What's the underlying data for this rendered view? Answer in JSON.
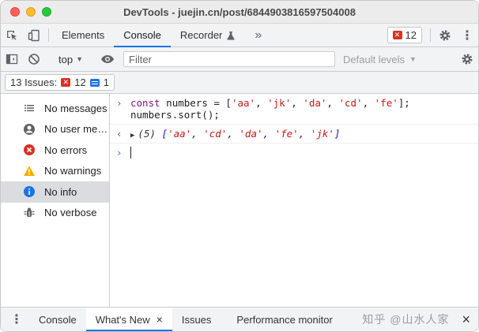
{
  "window": {
    "title": "DevTools - juejin.cn/post/6844903816597504008"
  },
  "tabs": [
    {
      "label": "Elements"
    },
    {
      "label": "Console"
    },
    {
      "label": "Recorder"
    }
  ],
  "error_badge": {
    "count": "12"
  },
  "toolbar": {
    "context": "top",
    "filter_placeholder": "Filter",
    "levels": "Default levels"
  },
  "issues": {
    "label": "13 Issues:",
    "errors": "12",
    "info": "1"
  },
  "sidebar": {
    "items": [
      {
        "label": "No messages",
        "icon": "list-icon"
      },
      {
        "label": "No user me…",
        "icon": "user-icon"
      },
      {
        "label": "No errors",
        "icon": "error-icon"
      },
      {
        "label": "No warnings",
        "icon": "warning-icon"
      },
      {
        "label": "No info",
        "icon": "info-icon",
        "selected": true
      },
      {
        "label": "No verbose",
        "icon": "bug-icon"
      }
    ]
  },
  "console": {
    "input_line1": {
      "kw": "const",
      "rest": " numbers = [",
      "s1": "'aa'",
      "s2": "'jk'",
      "s3": "'da'",
      "s4": "'cd'",
      "s5": "'fe'",
      "end": "];"
    },
    "input_line2": "numbers.sort();",
    "result": {
      "count": "(5)",
      "items": [
        "'aa'",
        "'cd'",
        "'da'",
        "'fe'",
        "'jk'"
      ]
    }
  },
  "drawer": {
    "tabs": [
      {
        "label": "Console"
      },
      {
        "label": "What's New"
      },
      {
        "label": "Issues"
      },
      {
        "label": "Performance monitor"
      }
    ],
    "watermark": "知乎 @山水人家"
  },
  "colors": {
    "accent": "#1a73e8",
    "error": "#d93025",
    "warning": "#f9ab00"
  }
}
